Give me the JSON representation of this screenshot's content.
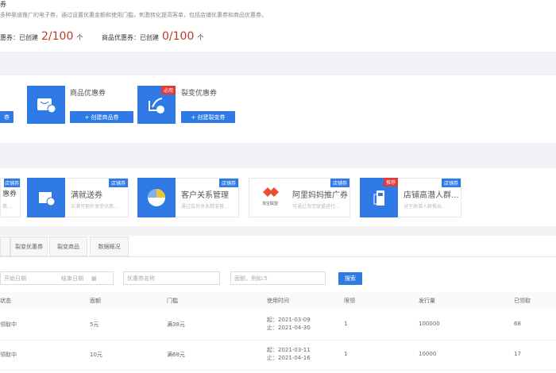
{
  "header": {
    "title": "券",
    "description": "多种渠道推广的电子券，通过设置优惠金额和使用门槛，刺激转化提高客单，包括店铺优惠券和商品优惠券。",
    "stats": [
      {
        "label": "惠券：已创建",
        "value": "2/100",
        "unit": "个"
      },
      {
        "label": "商品优惠券：已创建",
        "value": "0/100",
        "unit": "个"
      }
    ]
  },
  "create": {
    "partial_button": "券",
    "items": [
      {
        "title": "商品优惠券",
        "button": "+ 创建商品券",
        "icon": "shopping-bag-icon"
      },
      {
        "title": "裂变优惠券",
        "button": "+ 创建裂变券",
        "badge": "必用",
        "icon": "share-icon"
      }
    ]
  },
  "tools": {
    "partial": {
      "title": "惠券",
      "subtitle": "策...",
      "badge": "店铺券"
    },
    "items": [
      {
        "title": "满就送券",
        "subtitle": "买满可额外享受优惠...",
        "badge": "店铺券",
        "icon": "store-icon"
      },
      {
        "title": "客户关系管理",
        "subtitle": "通过会员体系精准营...",
        "badge": "店铺券",
        "icon": "pinwheel-icon"
      },
      {
        "title": "阿里妈妈推广券",
        "subtitle": "可通过淘宝联盟进行...",
        "badge": "店铺券",
        "logo_text": "淘宝联盟",
        "icon": "alimama-logo"
      },
      {
        "title": "店铺高潜人群...",
        "subtitle": "对于高潜人群推出...",
        "badge": "店铺券",
        "badge2": "推荐",
        "icon": "gas-pump-icon"
      }
    ]
  },
  "tabs": [
    "裂变优惠券",
    "裂变商品",
    "数据概况"
  ],
  "filters": {
    "start": "开始日期",
    "end": "结束日期",
    "name_placeholder": "优惠券名称",
    "amount_placeholder": "面额，例如:5",
    "search": "搜索"
  },
  "table": {
    "headers": [
      "状态",
      "面额",
      "门槛",
      "使用时间",
      "限领",
      "发行量",
      "已领取"
    ],
    "rows": [
      {
        "status": "领取中",
        "amount": "5元",
        "threshold": "满38元",
        "start": "起：2021-03-09",
        "end": "止：2021-04-30",
        "limit": "1",
        "issued": "100000",
        "claimed": "68"
      },
      {
        "status": "领取中",
        "amount": "10元",
        "threshold": "满68元",
        "start": "起：2021-03-11",
        "end": "止：2021-04-16",
        "limit": "1",
        "issued": "10000",
        "claimed": "17"
      }
    ]
  },
  "colors": {
    "accent": "#2f7ae5",
    "red": "#c0392b"
  }
}
